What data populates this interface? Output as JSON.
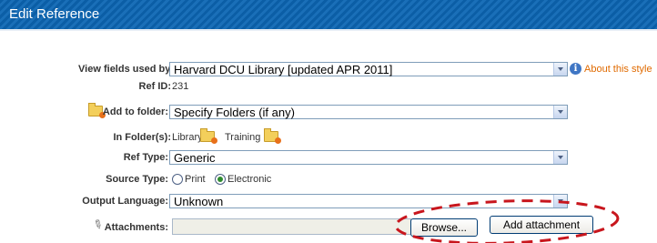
{
  "header": {
    "title": "Edit Reference"
  },
  "form": {
    "view_fields_label": "View fields used by:",
    "view_fields_value": "Harvard DCU Library [updated APR 2011]",
    "about_style": "About this style",
    "ref_id_label": "Ref ID:",
    "ref_id_value": "231",
    "add_folder_label": "Add to folder:",
    "add_folder_value": "Specify Folders (if any)",
    "in_folders_label": "In Folder(s):",
    "folders": [
      "Library",
      "Training"
    ],
    "ref_type_label": "Ref Type:",
    "ref_type_value": "Generic",
    "source_type_label": "Source Type:",
    "source_options": [
      "Print",
      "Electronic"
    ],
    "source_selected": "Electronic",
    "output_language_label": "Output Language:",
    "output_language_value": "Unknown",
    "attachments_label": "Attachments:",
    "browse_label": "Browse...",
    "add_attachment_label": "Add attachment"
  },
  "icons": {
    "info": "info-icon",
    "folder": "folder-add-icon",
    "clip": "paperclip-icon"
  },
  "colors": {
    "header": "#0b5ea6",
    "link": "#e06a00",
    "annotation": "#c8161d"
  }
}
